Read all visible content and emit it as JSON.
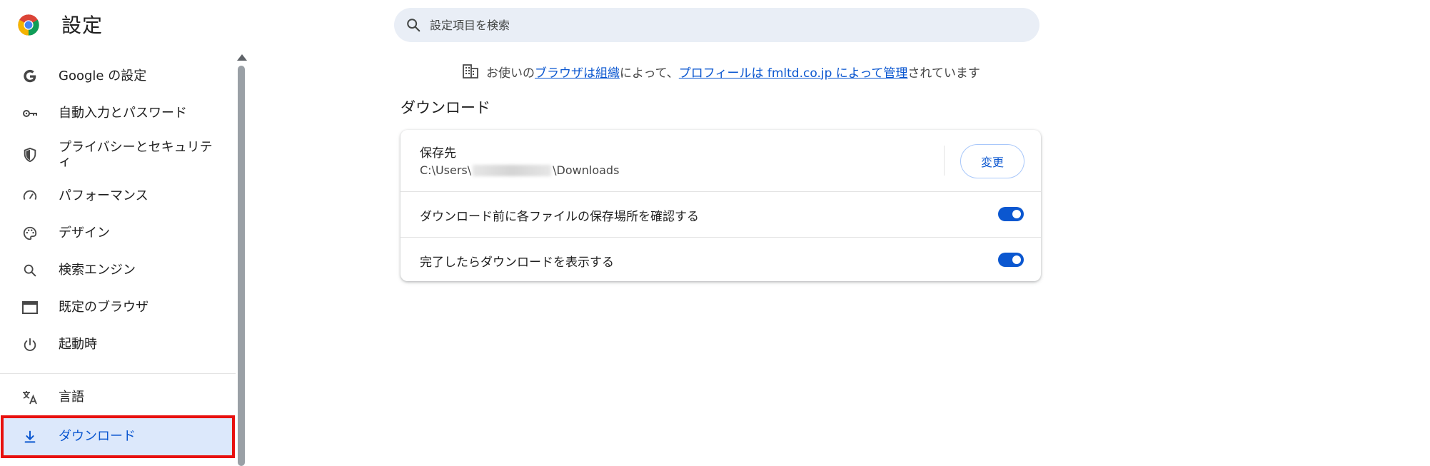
{
  "header": {
    "title": "設定",
    "search_placeholder": "設定項目を検索"
  },
  "sidebar": {
    "items": [
      {
        "label": "Google の設定",
        "icon": "google-g-icon"
      },
      {
        "label": "自動入力とパスワード",
        "icon": "key-icon"
      },
      {
        "label": "プライバシーとセキュリティ",
        "icon": "shield-icon"
      },
      {
        "label": "パフォーマンス",
        "icon": "speedometer-icon"
      },
      {
        "label": "デザイン",
        "icon": "palette-icon"
      },
      {
        "label": "検索エンジン",
        "icon": "search-icon"
      },
      {
        "label": "既定のブラウザ",
        "icon": "browser-window-icon"
      },
      {
        "label": "起動時",
        "icon": "power-icon"
      },
      {
        "label": "言語",
        "icon": "translate-icon"
      },
      {
        "label": "ダウンロード",
        "icon": "download-icon",
        "active": true
      }
    ]
  },
  "notice": {
    "prefix": "お使いの",
    "link1": "ブラウザは組織",
    "middle": "によって、",
    "link2": "プロフィールは fmltd.co.jp によって管理",
    "suffix": "されています"
  },
  "downloads": {
    "section_title": "ダウンロード",
    "location_label": "保存先",
    "path_prefix": "C:\\Users\\",
    "path_suffix": "\\Downloads",
    "change_button": "変更",
    "ask_where_label": "ダウンロード前に各ファイルの保存場所を確認する",
    "ask_where_enabled": true,
    "show_when_done_label": "完了したらダウンロードを表示する",
    "show_when_done_enabled": true
  },
  "colors": {
    "accent": "#0b57d0",
    "active_bg": "#dce8fb",
    "highlight_border": "#e8100e",
    "search_bg": "#e9eef6"
  }
}
